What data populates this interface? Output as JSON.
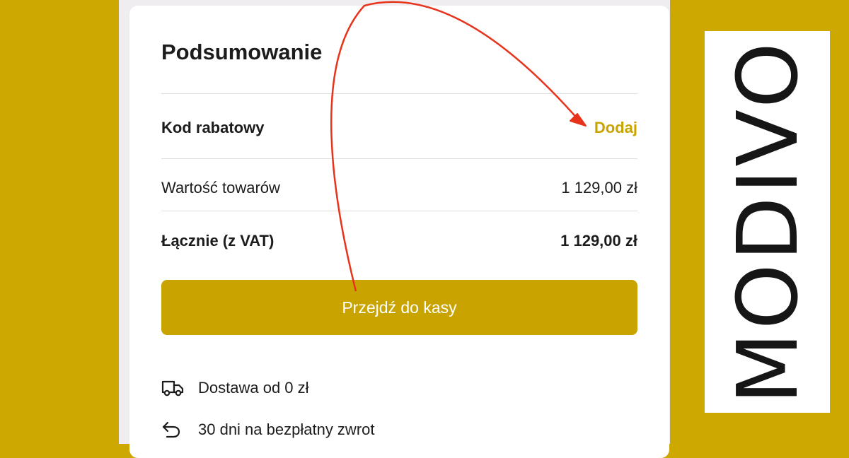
{
  "summary": {
    "title": "Podsumowanie",
    "discount_label": "Kod rabatowy",
    "discount_action": "Dodaj",
    "goods_value_label": "Wartość towarów",
    "goods_value": "1 129,00 zł",
    "total_label": "Łącznie (z VAT)",
    "total_value": "1 129,00 zł",
    "checkout_button": "Przejdź do kasy",
    "perks": [
      {
        "icon": "delivery-truck-icon",
        "text": "Dostawa od 0 zł"
      },
      {
        "icon": "return-arrow-icon",
        "text": "30 dni na bezpłatny zwrot"
      }
    ]
  },
  "brand": {
    "logo_text": "MODIVO"
  },
  "colors": {
    "accent": "#c9a400",
    "background": "#cda800",
    "annotation_arrow": "#e8331c",
    "text": "#1c1c1c"
  }
}
